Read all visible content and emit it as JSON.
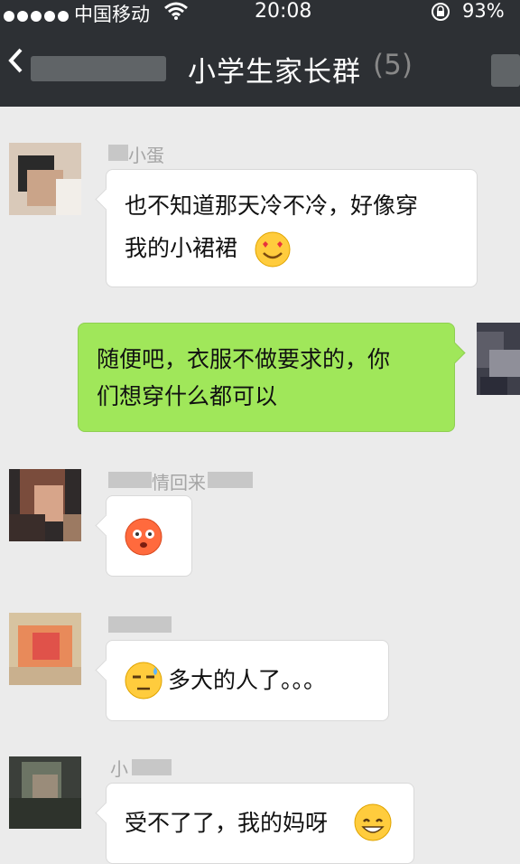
{
  "status_bar": {
    "carrier": "中国移动",
    "time": "20:08",
    "battery": "93%",
    "signal_dots": 5,
    "icons": [
      "signal-dots-icon",
      "wifi-icon",
      "orientation-lock-icon"
    ]
  },
  "header": {
    "back_icon": "chevron-left-icon",
    "title": "小学生家长群",
    "count_suffix": "(5)"
  },
  "messages": [
    {
      "sender_nick": "小蛋",
      "side": "left",
      "lines": [
        "也不知道那天冷不冷，好像穿",
        "我的小裙裙"
      ],
      "emoji": "heart-eyes-emoji"
    },
    {
      "sender_nick": "",
      "side": "right",
      "lines": [
        "随便吧，衣服不做要求的，你",
        "们想穿什么都可以"
      ]
    },
    {
      "sender_nick": "情回来",
      "side": "left",
      "lines": [],
      "emoji": "flushed-emoji"
    },
    {
      "sender_nick": "",
      "side": "left",
      "lines": [
        "多大的人了。。。"
      ],
      "emoji": "unamused-sweat-emoji"
    },
    {
      "sender_nick": "小",
      "side": "left",
      "lines": [
        "受不了了，我的妈呀"
      ],
      "emoji": "grin-sweat-emoji"
    }
  ]
}
